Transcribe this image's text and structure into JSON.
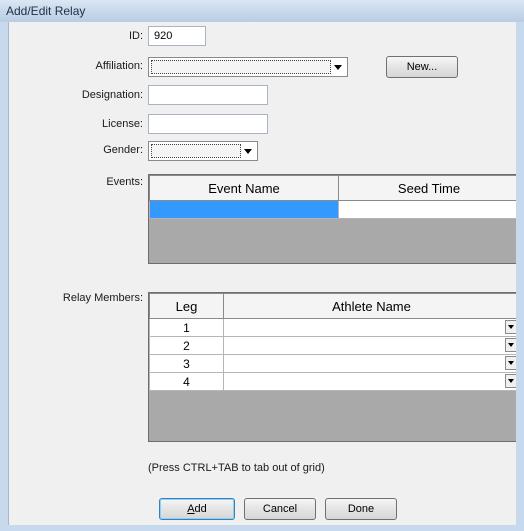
{
  "window": {
    "title": "Add/Edit Relay"
  },
  "form": {
    "id_label": "ID:",
    "id_value": "920",
    "affiliation_label": "Affiliation:",
    "affiliation_value": "",
    "new_button": "New...",
    "designation_label": "Designation:",
    "designation_value": "",
    "license_label": "License:",
    "license_value": "",
    "gender_label": "Gender:",
    "gender_value": ""
  },
  "events": {
    "label": "Events:",
    "columns": [
      "Event Name",
      "Seed Time"
    ],
    "rows": [
      {
        "event_name": "",
        "seed_time": ""
      }
    ]
  },
  "relay_members": {
    "label": "Relay Members:",
    "columns": [
      "Leg",
      "Athlete Name"
    ],
    "rows": [
      {
        "leg": "1",
        "athlete": ""
      },
      {
        "leg": "2",
        "athlete": ""
      },
      {
        "leg": "3",
        "athlete": ""
      },
      {
        "leg": "4",
        "athlete": ""
      }
    ]
  },
  "hint": "(Press CTRL+TAB to tab out of grid)",
  "buttons": {
    "add_mnemonic": "A",
    "add_rest": "dd",
    "cancel": "Cancel",
    "done": "Done"
  }
}
